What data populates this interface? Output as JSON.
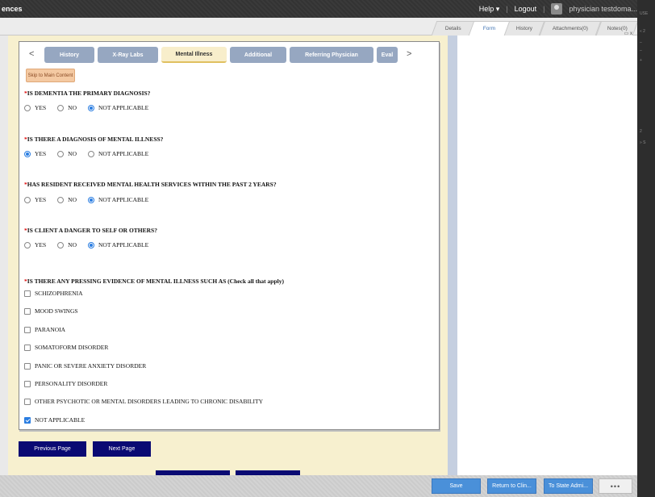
{
  "topbar": {
    "title": "ences",
    "help": "Help ▾",
    "logout": "Logout",
    "user": "physician testdoma..."
  },
  "tabs": [
    "Details",
    "Form",
    "History",
    "Attachments(0)",
    "Notes(0)"
  ],
  "active_tab": "Form",
  "form_tabs": [
    "History",
    "X-Ray Labs",
    "Mental Illness",
    "Additional",
    "Referring Physician",
    "Eval"
  ],
  "active_form_tab": "Mental Illness",
  "skip_label": "Skip to Main Content",
  "questions": [
    {
      "text": "IS DEMENTIA THE PRIMARY DIAGNOSIS?",
      "options": [
        "YES",
        "NO",
        "NOT APPLICABLE"
      ],
      "selected": "NOT APPLICABLE"
    },
    {
      "text": "IS THERE A DIAGNOSIS OF MENTAL ILLNESS?",
      "options": [
        "YES",
        "NO",
        "NOT APPLICABLE"
      ],
      "selected": "YES"
    },
    {
      "text": "HAS RESIDENT RECEIVED MENTAL HEALTH SERVICES WITHIN THE PAST 2 YEARS?",
      "options": [
        "YES",
        "NO",
        "NOT APPLICABLE"
      ],
      "selected": "NOT APPLICABLE"
    },
    {
      "text": "IS CLIENT A DANGER TO SELF OR OTHERS?",
      "options": [
        "YES",
        "NO",
        "NOT APPLICABLE"
      ],
      "selected": "NOT APPLICABLE"
    }
  ],
  "checklist": {
    "question": "IS THERE ANY PRESSING EVIDENCE OF MENTAL ILLNESS SUCH AS (Check all that apply)",
    "items": [
      {
        "label": "SCHIZOPHRENIA",
        "checked": false
      },
      {
        "label": "MOOD SWINGS",
        "checked": false
      },
      {
        "label": "PARANOIA",
        "checked": false
      },
      {
        "label": "SOMATOFORM DISORDER",
        "checked": false
      },
      {
        "label": "PANIC OR SEVERE ANXIETY DISORDER",
        "checked": false
      },
      {
        "label": "PERSONALITY DISORDER",
        "checked": false
      },
      {
        "label": "OTHER PSYCHOTIC OR MENTAL DISORDERS LEADING TO CHRONIC DISABILITY",
        "checked": false
      },
      {
        "label": "NOT APPLICABLE",
        "checked": true
      }
    ]
  },
  "nav": {
    "previous": "Previous Page",
    "next": "Next Page"
  },
  "bottom": {
    "save": "Save",
    "return": "Return to Clin...",
    "state": "To State Admi...",
    "more": "•••"
  },
  "rightstrip": [
    "USE",
    "«  2",
    "–",
    "–",
    "+",
    "2",
    "»  S"
  ]
}
